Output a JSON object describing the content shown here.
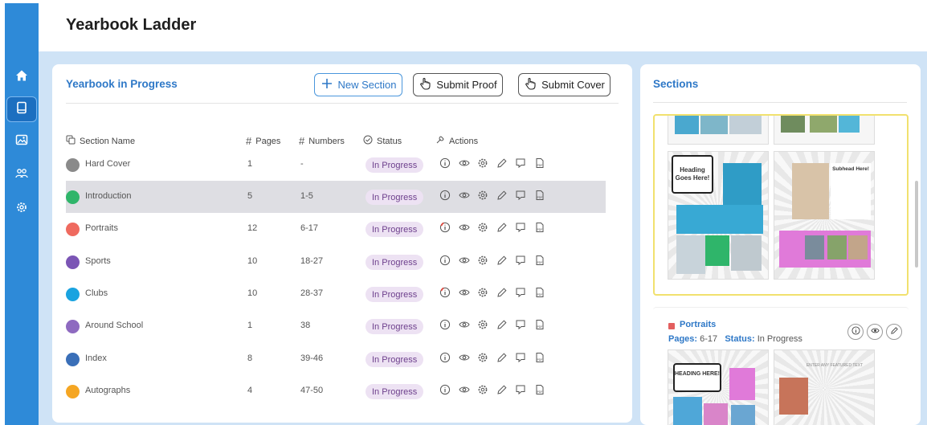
{
  "page": {
    "title": "Yearbook Ladder"
  },
  "sidebar": {
    "items": [
      {
        "name": "home",
        "icon": "home-icon",
        "active": false
      },
      {
        "name": "yearbook",
        "icon": "book-icon",
        "active": true
      },
      {
        "name": "photos",
        "icon": "image-icon",
        "active": false
      },
      {
        "name": "users",
        "icon": "users-icon",
        "active": false
      },
      {
        "name": "settings",
        "icon": "gear-icon",
        "active": false
      }
    ],
    "color": "#2e8ad8"
  },
  "progress_panel": {
    "heading": "Yearbook in Progress",
    "buttons": {
      "new_section": "New Section",
      "submit_proof": "Submit Proof",
      "submit_cover": "Submit Cover"
    },
    "columns": {
      "name": "Section Name",
      "pages": "Pages",
      "numbers": "Numbers",
      "status": "Status",
      "actions": "Actions"
    },
    "rows": [
      {
        "name": "Hard Cover",
        "pages": "1",
        "numbers": "-",
        "status": "In Progress",
        "color": "#8a8a8a",
        "flagged": false,
        "selected": false
      },
      {
        "name": "Introduction",
        "pages": "5",
        "numbers": "1-5",
        "status": "In Progress",
        "color": "#2fb56a",
        "flagged": false,
        "selected": true
      },
      {
        "name": "Portraits",
        "pages": "12",
        "numbers": "6-17",
        "status": "In Progress",
        "color": "#ef6a5f",
        "flagged": true,
        "selected": false
      },
      {
        "name": "Sports",
        "pages": "10",
        "numbers": "18-27",
        "status": "In Progress",
        "color": "#7b55b5",
        "flagged": false,
        "selected": false
      },
      {
        "name": "Clubs",
        "pages": "10",
        "numbers": "28-37",
        "status": "In Progress",
        "color": "#1aa3e0",
        "flagged": true,
        "selected": false
      },
      {
        "name": "Around School",
        "pages": "1",
        "numbers": "38",
        "status": "In Progress",
        "color": "#8e6ac0",
        "flagged": false,
        "selected": false
      },
      {
        "name": "Index",
        "pages": "8",
        "numbers": "39-46",
        "status": "In Progress",
        "color": "#3a6fb8",
        "flagged": false,
        "selected": false
      },
      {
        "name": "Autographs",
        "pages": "4",
        "numbers": "47-50",
        "status": "In Progress",
        "color": "#f5a623",
        "flagged": false,
        "selected": false
      }
    ]
  },
  "sections_panel": {
    "heading": "Sections",
    "card1": {
      "left_bubble": "Heading Goes Here!",
      "right_heading": "Subhead Here!"
    },
    "card2": {
      "title": "Portraits",
      "pages_label": "Pages:",
      "pages_value": "6-17",
      "status_label": "Status:",
      "status_value": "In Progress",
      "bubble": "HEADING HERE!",
      "right_caption": "ENTER ANY FEATURED TEXT"
    }
  }
}
